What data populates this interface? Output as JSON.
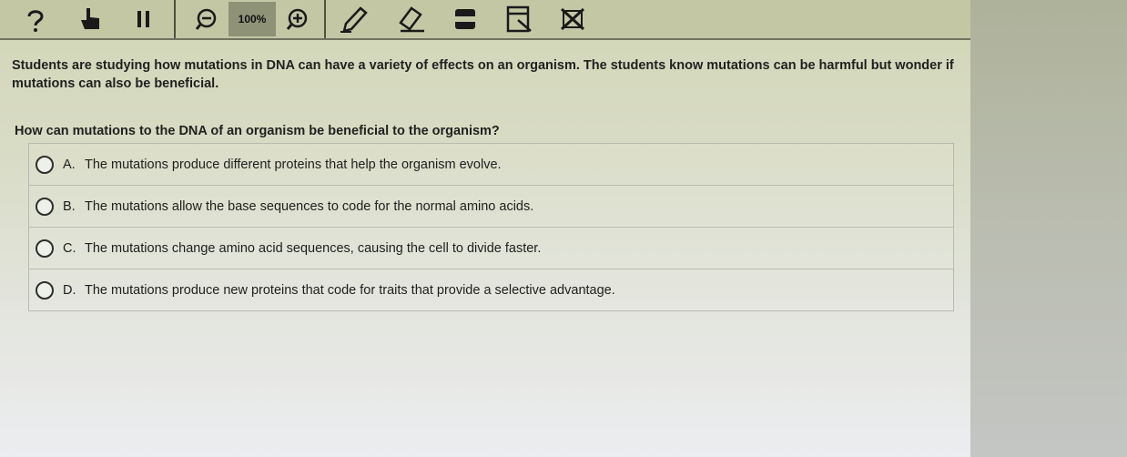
{
  "toolbar": {
    "zoom_level": "100%",
    "icons": [
      "help-icon",
      "pointer-hand-icon",
      "pause-icon",
      "zoom-out-icon",
      "zoom-in-icon",
      "pen-icon",
      "eraser-icon",
      "line-reader-icon",
      "notepad-icon",
      "option-eliminator-icon"
    ]
  },
  "question": {
    "stem": "Students are studying how mutations in DNA can have a variety of effects on an organism. The students know mutations can be harmful but wonder if mutations can also be beneficial.",
    "prompt": "How can mutations to the DNA of an organism be beneficial to the organism?",
    "options": [
      {
        "letter": "A.",
        "text": "The mutations produce different proteins that help the organism evolve."
      },
      {
        "letter": "B.",
        "text": "The mutations allow the base sequences to code for the normal amino acids."
      },
      {
        "letter": "C.",
        "text": "The mutations change amino acid sequences, causing the cell to divide faster."
      },
      {
        "letter": "D.",
        "text": "The mutations produce new proteins that code for traits that provide a selective advantage."
      }
    ]
  }
}
